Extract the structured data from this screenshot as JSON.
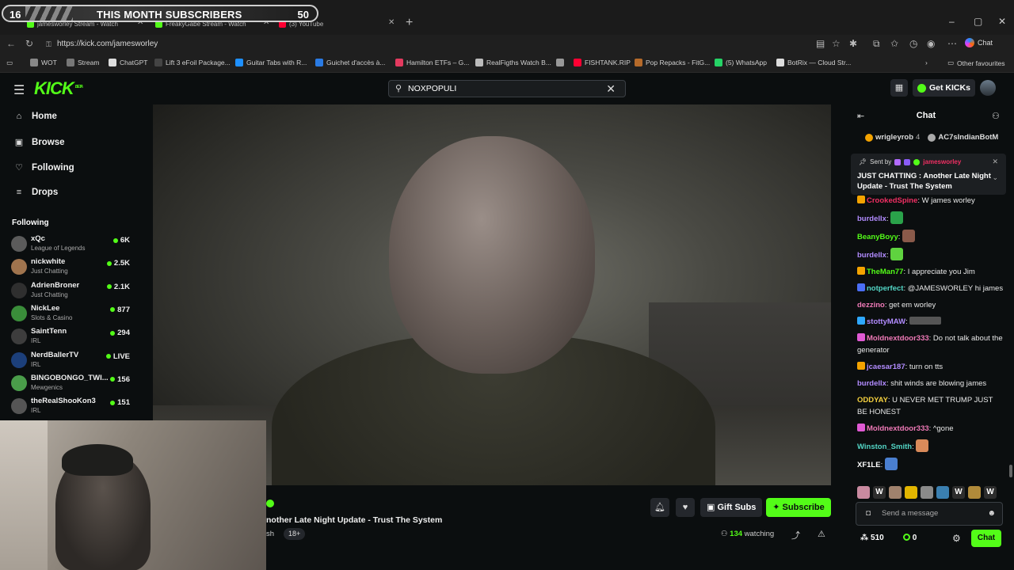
{
  "overlay": {
    "subs_label": "THIS MONTH SUBSCRIBERS",
    "current": "16",
    "goal": "50"
  },
  "browser": {
    "tabs": [
      {
        "label": "jamesworley Stream - Watch",
        "fav_color": "#53fc18"
      },
      {
        "label": "FreakyGabe Stream - Watch",
        "fav_color": "#53fc18"
      },
      {
        "label": "(3) YouTube",
        "fav_color": "#ff0033"
      }
    ],
    "url": "https://kick.com/jamesworley",
    "copilot_label": "Chat",
    "bookmarks": [
      {
        "label": "WOT",
        "color": "#888"
      },
      {
        "label": "Stream",
        "color": "#777"
      },
      {
        "label": "ChatGPT",
        "color": "#ddd"
      },
      {
        "label": "Lift 3 eFoil Package...",
        "color": "#444"
      },
      {
        "label": "Guitar Tabs with R...",
        "color": "#1e90ff"
      },
      {
        "label": "Guichet d'accès à...",
        "color": "#2a7be4"
      },
      {
        "label": "Hamilton ETFs – G...",
        "color": "#e33a5f"
      },
      {
        "label": "RealFigths Watch B...",
        "color": "#bbb"
      },
      {
        "label": "",
        "color": "#999"
      },
      {
        "label": "FISHTANK.RIP",
        "color": "#f03"
      },
      {
        "label": "Pop Repacks - FitG...",
        "color": "#b56a2a"
      },
      {
        "label": "(5) WhatsApp",
        "color": "#25d366"
      },
      {
        "label": "BotRix — Cloud Str...",
        "color": "#ddd"
      }
    ],
    "other_favourites": "Other favourites"
  },
  "header": {
    "logo": "KICK",
    "logo_beta": "BETA",
    "search_value": "NOXPOPULI",
    "get_kicks": "Get KICKs"
  },
  "sidebar": {
    "nav": [
      {
        "label": "Home",
        "icon": "⌂"
      },
      {
        "label": "Browse",
        "icon": "▣"
      },
      {
        "label": "Following",
        "icon": "♡"
      },
      {
        "label": "Drops",
        "icon": "≡"
      }
    ],
    "following_heading": "Following",
    "channels": [
      {
        "name": "xQc",
        "category": "League of Legends",
        "viewers": "6K",
        "color": "#5b5b5b"
      },
      {
        "name": "nickwhite",
        "category": "Just Chatting",
        "viewers": "2.5K",
        "color": "#a0744e"
      },
      {
        "name": "AdrienBroner",
        "category": "Just Chatting",
        "viewers": "2.1K",
        "color": "#2f2f2f"
      },
      {
        "name": "NickLee",
        "category": "Slots & Casino",
        "viewers": "877",
        "color": "#3a8d3a"
      },
      {
        "name": "SaintTenn",
        "category": "IRL",
        "viewers": "294",
        "color": "#3d3d3d"
      },
      {
        "name": "NerdBallerTV",
        "category": "IRL",
        "viewers": "LIVE",
        "color": "#1c3f7a"
      },
      {
        "name": "BINGOBONGO_TWI...",
        "category": "Mewgenics",
        "viewers": "156",
        "color": "#4a9d4a"
      },
      {
        "name": "theRealShooKon3",
        "category": "IRL",
        "viewers": "151",
        "color": "#555"
      }
    ]
  },
  "stream": {
    "title": "nother Late Night Update - Trust The System",
    "category_fragment": "sh",
    "tag": "18+",
    "gift_subs": "Gift Subs",
    "subscribe": "Subscribe",
    "watching_count": "134",
    "watching_label": "watching"
  },
  "chat": {
    "title": "Chat",
    "gifters": [
      {
        "name": "wrigleyrob",
        "count": "4",
        "color": "#f4a300"
      },
      {
        "name": "AC7sIndianBotM",
        "count": "",
        "color": "#aaa"
      }
    ],
    "pinned": {
      "sent_by": "Sent by",
      "user": "jamesworley",
      "message": "JUST CHATTING : Another Late Night Update - Trust The System"
    },
    "messages": [
      {
        "user": "CrookedSpine",
        "color": "#f02f63",
        "text": ": W james worley",
        "badge": "#f4a300"
      },
      {
        "user": "burdellx",
        "color": "#b28cff",
        "text": ":",
        "emote": "#2aa24a"
      },
      {
        "user": "BeanyBoyy",
        "color": "#53fc18",
        "text": ":",
        "emote": "#8a5a4a"
      },
      {
        "user": "burdellx",
        "color": "#b28cff",
        "text": ":",
        "emote": "#5fd33f"
      },
      {
        "user": "TheMan77",
        "color": "#53fc18",
        "text": ": I appreciate you Jim",
        "badge": "#f4a300"
      },
      {
        "user": "notperfect",
        "color": "#53d6c6",
        "text": ": @JAMESWORLEY hi james",
        "badge": "#4b6ef5"
      },
      {
        "user": "dezzino",
        "color": "#f07ab8",
        "text": ": get em worley"
      },
      {
        "user": "stottyMAW",
        "color": "#b28cff",
        "text": ":",
        "badge": "#2ea8ff",
        "blur": true
      },
      {
        "user": "Moldnextdoor333",
        "color": "#f07ab8",
        "text": ": Do not talk about the generator",
        "badge": "#e05ad3"
      },
      {
        "user": "jcaesar187",
        "color": "#b28cff",
        "text": ": turn on tts",
        "badge": "#f4a300"
      },
      {
        "user": "burdellx",
        "color": "#b28cff",
        "text": ": shit winds are blowing james"
      },
      {
        "user": "ODDYAY",
        "color": "#f4d03f",
        "text": ": U NEVER MET TRUMP JUST BE HONEST"
      },
      {
        "user": "Moldnextdoor333",
        "color": "#f07ab8",
        "text": ": ^gone",
        "badge": "#e05ad3"
      },
      {
        "user": "Winston_Smith",
        "color": "#53d6c6",
        "text": ":",
        "emote": "#d98a5a"
      },
      {
        "user": "XF1LE",
        "color": "#ffffff",
        "text": ":",
        "emote": "#4a7fd0"
      }
    ],
    "emotes": [
      {
        "label": "",
        "color": "#c98aa0"
      },
      {
        "label": "W",
        "color": "#2d2d2d"
      },
      {
        "label": "",
        "color": "#a0826d"
      },
      {
        "label": "",
        "color": "#e2b500"
      },
      {
        "label": "",
        "color": "#8a8a8a"
      },
      {
        "label": "",
        "color": "#3a7fb0"
      },
      {
        "label": "W",
        "color": "#2d2d2d"
      },
      {
        "label": "",
        "color": "#b08a3a"
      },
      {
        "label": "W",
        "color": "#2d2d2d"
      }
    ],
    "input_placeholder": "Send a message",
    "points": "510",
    "gems": "0",
    "send_label": "Chat"
  }
}
